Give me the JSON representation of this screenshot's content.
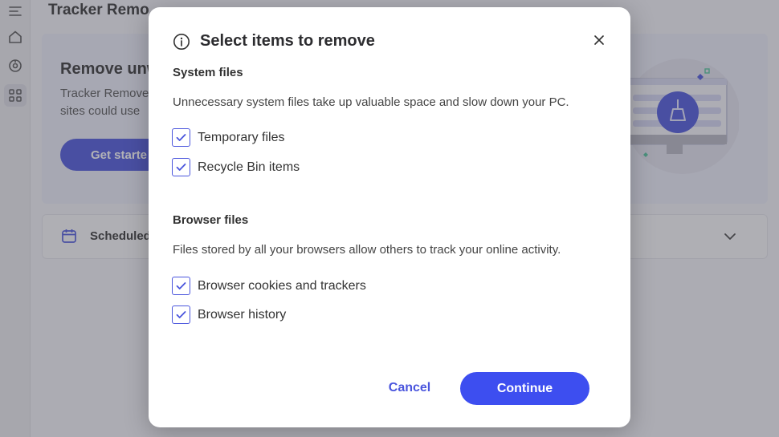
{
  "app": {
    "title": "Tracker Remo"
  },
  "sidebar": {
    "items": [
      {
        "icon": "menu-icon"
      },
      {
        "icon": "home-icon"
      },
      {
        "icon": "privacy-icon"
      },
      {
        "icon": "apps-grid-icon"
      }
    ]
  },
  "hero": {
    "title": "Remove unw",
    "description": "Tracker Remove sites could use",
    "button_label": "Get starte"
  },
  "scheduled": {
    "label": "Scheduled",
    "icon": "calendar-icon"
  },
  "modal": {
    "title": "Select items to remove",
    "sections": [
      {
        "title": "System files",
        "description": "Unnecessary system files take up valuable space and slow down your PC.",
        "items": [
          {
            "label": "Temporary files",
            "checked": true
          },
          {
            "label": "Recycle Bin items",
            "checked": true
          }
        ]
      },
      {
        "title": "Browser files",
        "description": "Files stored by all your browsers allow others to track your online activity.",
        "items": [
          {
            "label": "Browser cookies and trackers",
            "checked": true
          },
          {
            "label": "Browser history",
            "checked": true
          }
        ]
      }
    ],
    "cancel_label": "Cancel",
    "continue_label": "Continue"
  },
  "colors": {
    "accent": "#3d4ef0",
    "checkbox_border": "#4a55dd",
    "overlay": "#48484f"
  }
}
